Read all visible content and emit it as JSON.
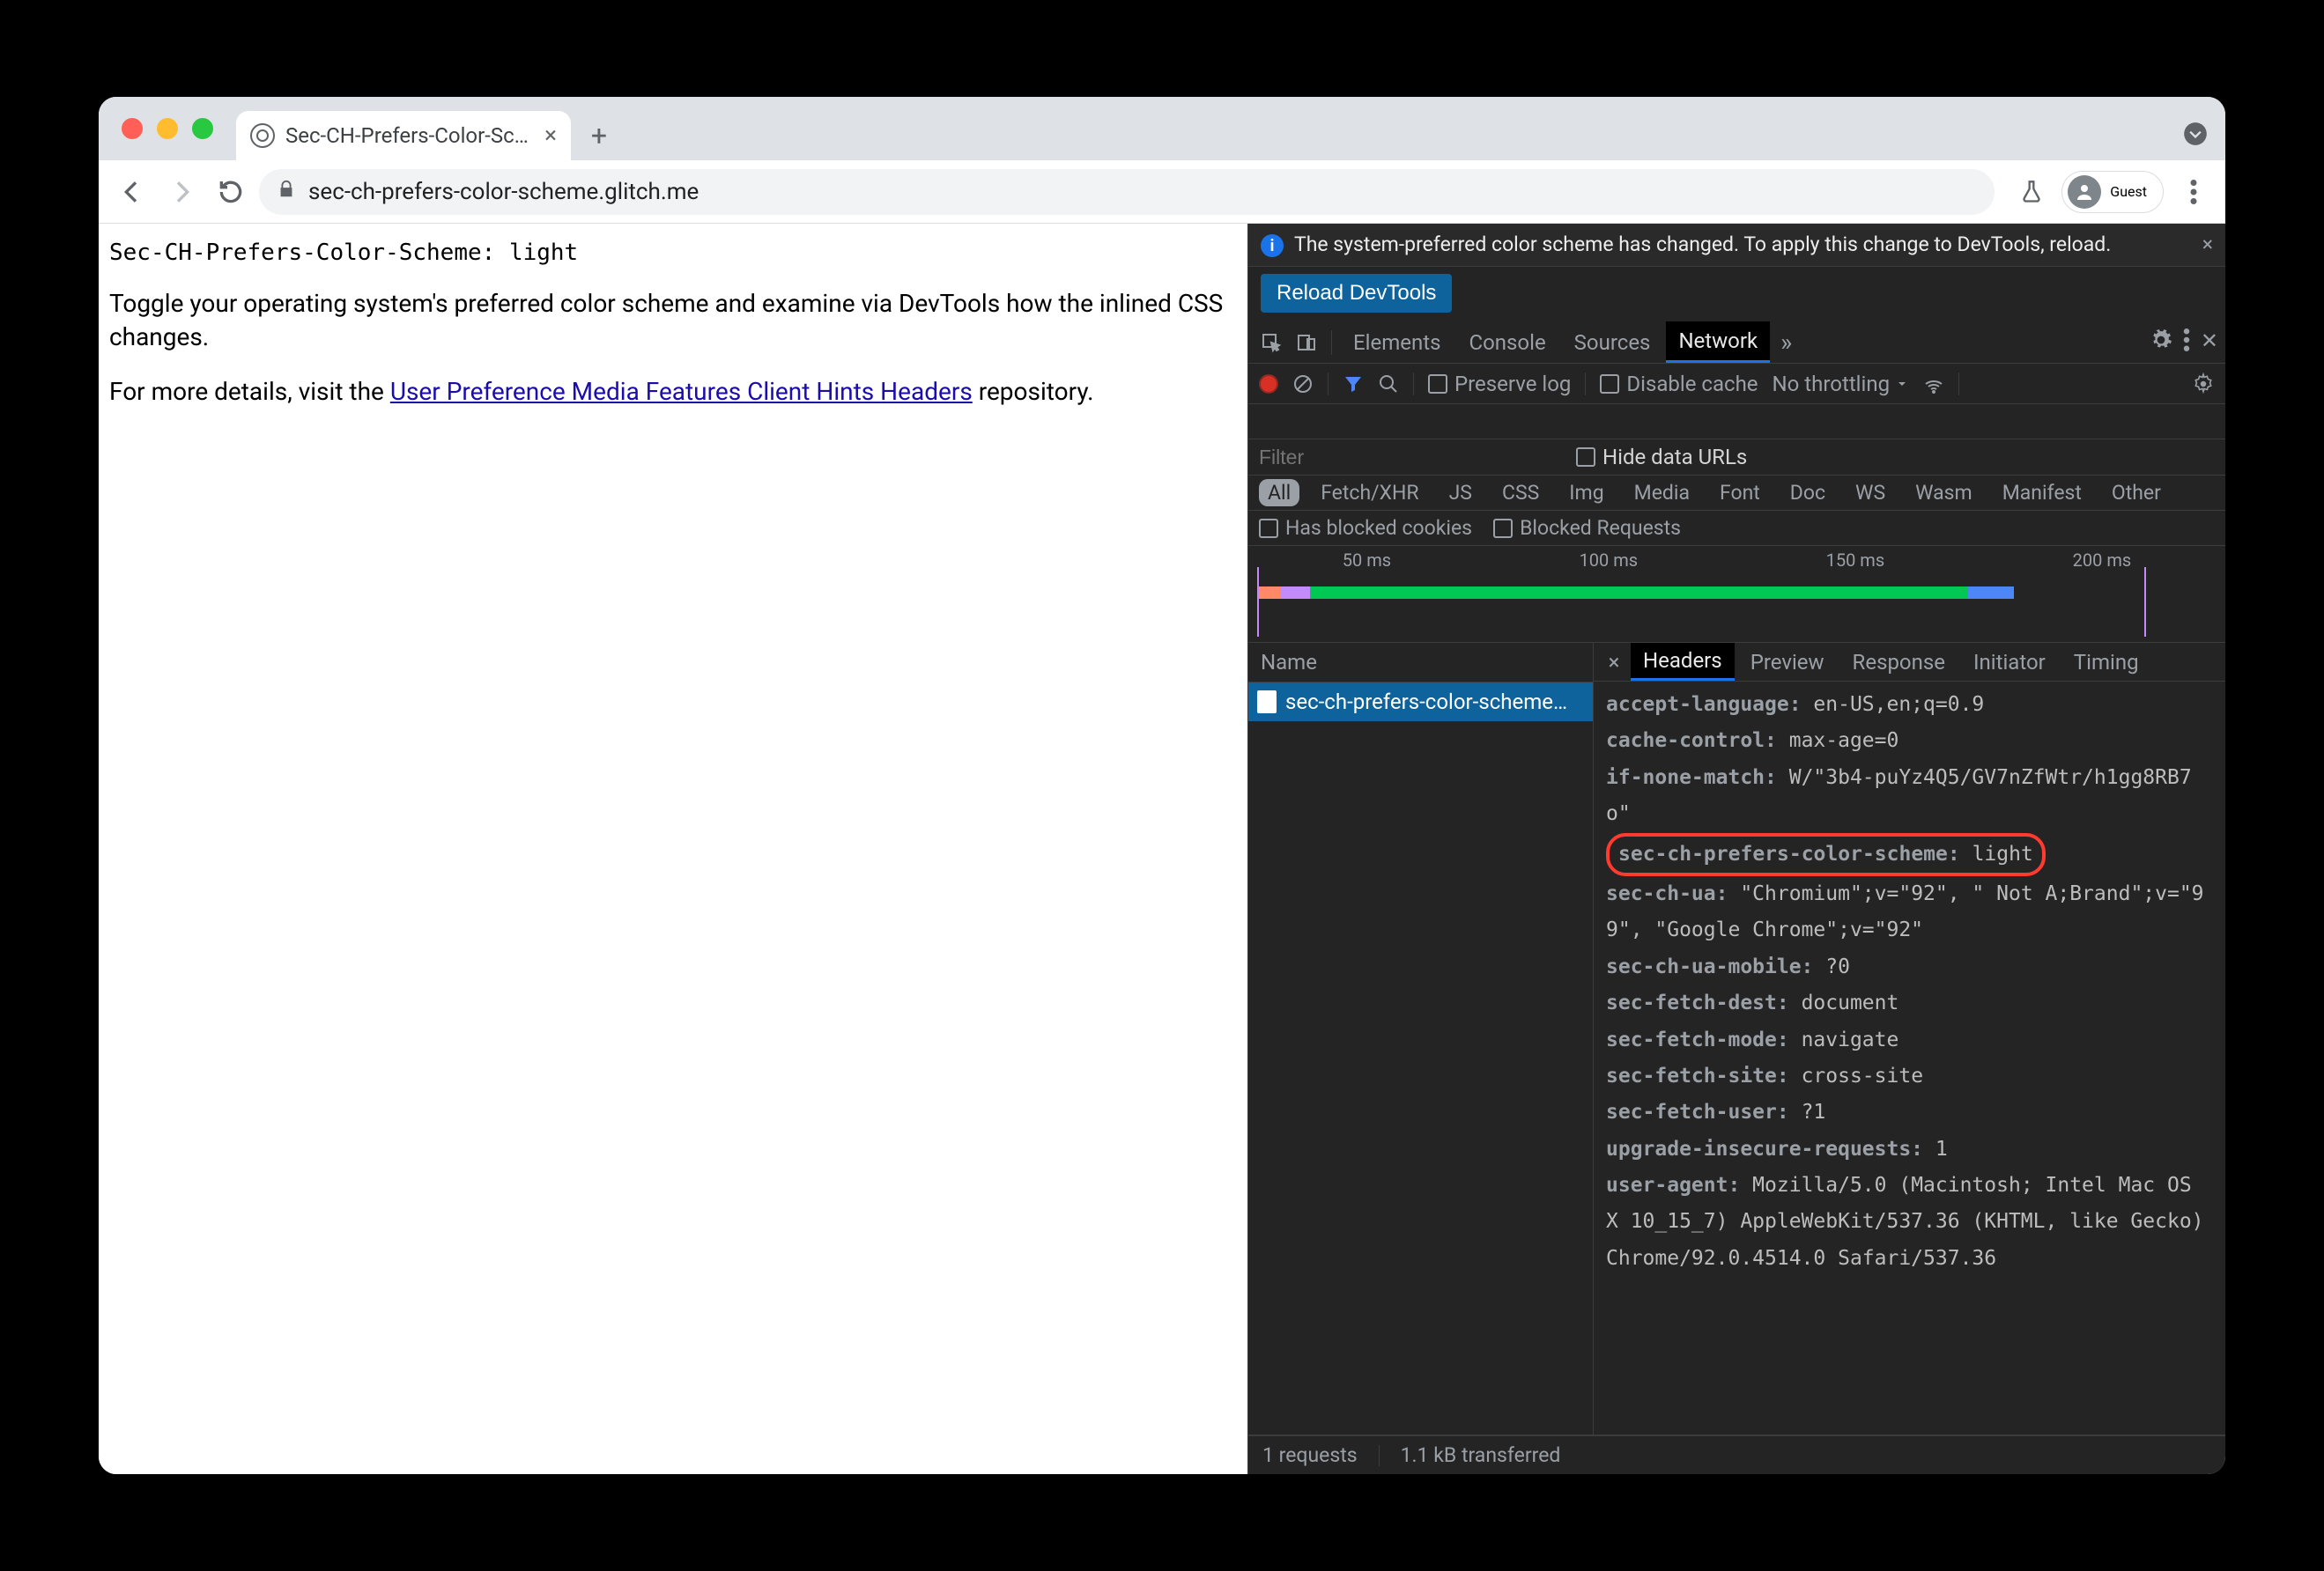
{
  "browser": {
    "tab_title": "Sec-CH-Prefers-Color-Schem…",
    "url_display": "sec-ch-prefers-color-scheme.glitch.me",
    "guest_label": "Guest"
  },
  "page": {
    "mono_line": "Sec-CH-Prefers-Color-Scheme: light",
    "p1": "Toggle your operating system's preferred color scheme and examine via DevTools how the inlined CSS changes.",
    "p2_pre": "For more details, visit the ",
    "p2_link": "User Preference Media Features Client Hints Headers",
    "p2_post": " repository."
  },
  "devtools": {
    "banner_text": "The system-preferred color scheme has changed. To apply this change to DevTools, reload.",
    "reload_btn": "Reload DevTools",
    "main_tabs": [
      "Elements",
      "Console",
      "Sources",
      "Network"
    ],
    "active_main_tab": "Network",
    "nw_controls": {
      "preserve_log": "Preserve log",
      "disable_cache": "Disable cache",
      "throttling": "No throttling"
    },
    "filter_placeholder": "Filter",
    "hide_data_urls": "Hide data URLs",
    "type_filters": [
      "All",
      "Fetch/XHR",
      "JS",
      "CSS",
      "Img",
      "Media",
      "Font",
      "Doc",
      "WS",
      "Wasm",
      "Manifest",
      "Other"
    ],
    "active_type_filter": "All",
    "has_blocked_cookies": "Has blocked cookies",
    "blocked_requests": "Blocked Requests",
    "timeline_ticks": [
      "50 ms",
      "100 ms",
      "150 ms",
      "200 ms"
    ],
    "reqlist_header": "Name",
    "request_name": "sec-ch-prefers-color-scheme…",
    "detail_tabs": [
      "Headers",
      "Preview",
      "Response",
      "Initiator",
      "Timing"
    ],
    "active_detail_tab": "Headers",
    "headers": [
      {
        "k": "accept-language:",
        "v": " en-US,en;q=0.9"
      },
      {
        "k": "cache-control:",
        "v": " max-age=0"
      },
      {
        "k": "if-none-match:",
        "v": " W/\"3b4-puYz4Q5/GV7nZfWtr/h1gg8RB7o\""
      },
      {
        "k": "sec-ch-prefers-color-scheme:",
        "v": " light",
        "hl": true
      },
      {
        "k": "sec-ch-ua:",
        "v": " \"Chromium\";v=\"92\", \" Not A;Brand\";v=\"99\", \"Google Chrome\";v=\"92\""
      },
      {
        "k": "sec-ch-ua-mobile:",
        "v": " ?0"
      },
      {
        "k": "sec-fetch-dest:",
        "v": " document"
      },
      {
        "k": "sec-fetch-mode:",
        "v": " navigate"
      },
      {
        "k": "sec-fetch-site:",
        "v": " cross-site"
      },
      {
        "k": "sec-fetch-user:",
        "v": " ?1"
      },
      {
        "k": "upgrade-insecure-requests:",
        "v": " 1"
      },
      {
        "k": "user-agent:",
        "v": " Mozilla/5.0 (Macintosh; Intel Mac OS X 10_15_7) AppleWebKit/537.36 (KHTML, like Gecko) Chrome/92.0.4514.0 Safari/537.36"
      }
    ],
    "status": {
      "requests": "1 requests",
      "transferred": "1.1 kB transferred"
    }
  }
}
